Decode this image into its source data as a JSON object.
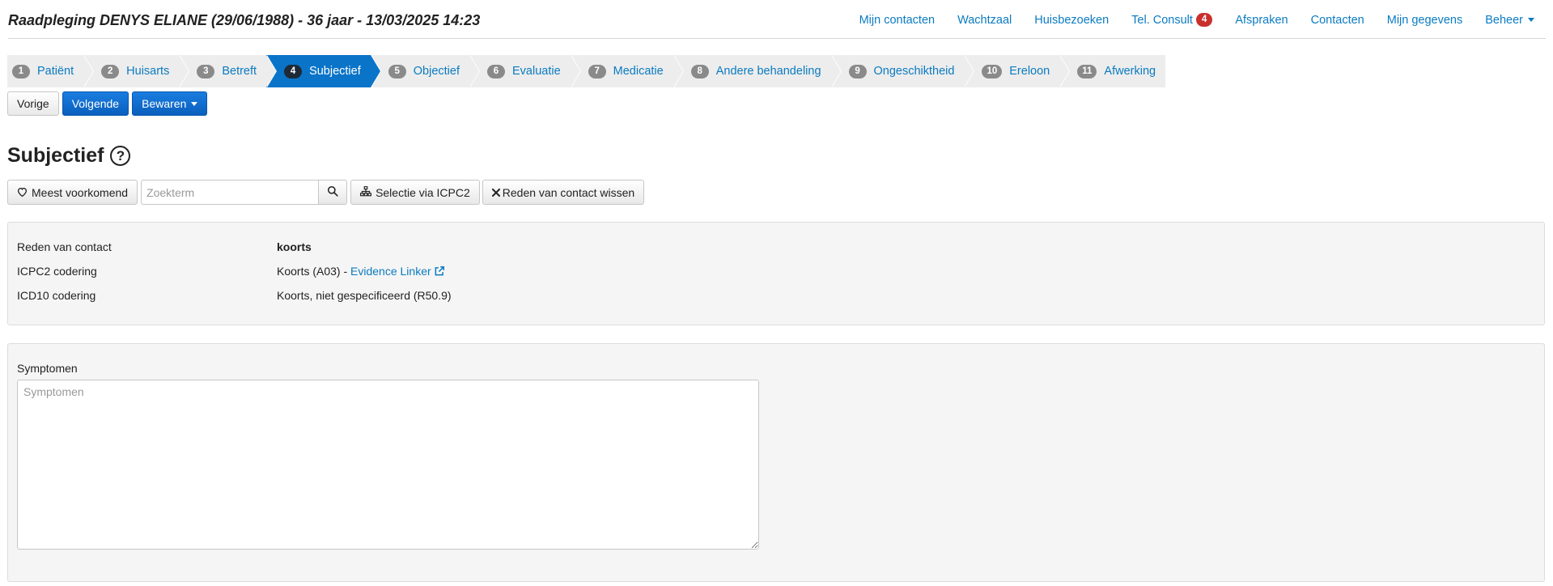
{
  "header": {
    "title": "Raadpleging DENYS ELIANE (29/06/1988) - 36 jaar - 13/03/2025 14:23",
    "nav": [
      {
        "label": "Mijn contacten"
      },
      {
        "label": "Wachtzaal"
      },
      {
        "label": "Huisbezoeken"
      },
      {
        "label": "Tel. Consult",
        "badge": "4"
      },
      {
        "label": "Afspraken"
      },
      {
        "label": "Contacten"
      },
      {
        "label": "Mijn gegevens"
      },
      {
        "label": "Beheer",
        "dropdown": true
      }
    ]
  },
  "steps": [
    {
      "num": "1",
      "label": "Patiënt"
    },
    {
      "num": "2",
      "label": "Huisarts"
    },
    {
      "num": "3",
      "label": "Betreft"
    },
    {
      "num": "4",
      "label": "Subjectief",
      "active": true
    },
    {
      "num": "5",
      "label": "Objectief"
    },
    {
      "num": "6",
      "label": "Evaluatie"
    },
    {
      "num": "7",
      "label": "Medicatie"
    },
    {
      "num": "8",
      "label": "Andere behandeling"
    },
    {
      "num": "9",
      "label": "Ongeschiktheid"
    },
    {
      "num": "10",
      "label": "Ereloon"
    },
    {
      "num": "11",
      "label": "Afwerking"
    }
  ],
  "buttons": {
    "previous": "Vorige",
    "next": "Volgende",
    "save": "Bewaren"
  },
  "section": {
    "title": "Subjectief",
    "help_icon": "?"
  },
  "toolbar": {
    "most_common": "Meest voorkomend",
    "search_placeholder": "Zoekterm",
    "search_value": "",
    "icpc_select": "Selectie via ICPC2",
    "clear_reason": "Reden van contact wissen"
  },
  "info": {
    "reason_label": "Reden van contact",
    "reason_value": "koorts",
    "icpc_label": "ICPC2 codering",
    "icpc_value": "Koorts (A03) - ",
    "icpc_link": "Evidence Linker",
    "icd_label": "ICD10 codering",
    "icd_value": "Koorts, niet gespecificeerd (R50.9)"
  },
  "symptoms": {
    "label": "Symptomen",
    "placeholder": "Symptomen",
    "value": ""
  },
  "colors": {
    "accent": "#0a74c9",
    "link": "#0a7bc1",
    "badge": "#c9302c",
    "step_bg": "#ededed",
    "panel_bg": "#f5f5f5"
  },
  "icons": {
    "heart": "heart-icon",
    "search": "search-icon",
    "sitemap": "sitemap-icon",
    "close": "close-icon",
    "external": "external-link-icon",
    "help": "question-circle-icon"
  }
}
